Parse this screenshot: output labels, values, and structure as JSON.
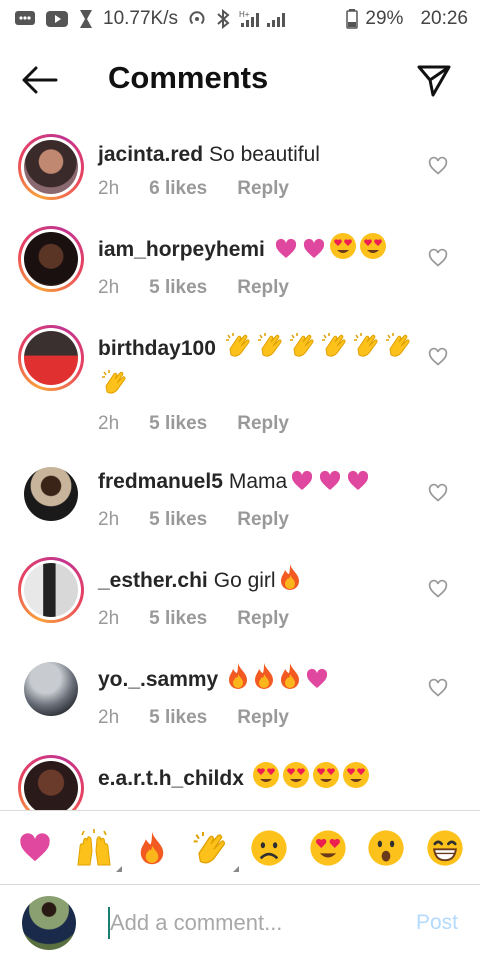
{
  "status": {
    "speed": "10.77K/s",
    "battery": "29%",
    "time": "20:26"
  },
  "header": {
    "title": "Comments"
  },
  "comments": [
    {
      "username": "jacinta.red",
      "text": "So beautiful",
      "emojis": [],
      "time": "2h",
      "likes": "6 likes",
      "reply": "Reply"
    },
    {
      "username": "iam_horpeyhemi",
      "text": "",
      "emojis": [
        "pink-heart",
        "pink-heart",
        "heart-eyes",
        "heart-eyes"
      ],
      "time": "2h",
      "likes": "5 likes",
      "reply": "Reply"
    },
    {
      "username": "birthday100",
      "text": "",
      "emojis": [
        "clap",
        "clap",
        "clap",
        "clap",
        "clap",
        "clap",
        "clap"
      ],
      "time": "2h",
      "likes": "5 likes",
      "reply": "Reply"
    },
    {
      "username": "fredmanuel5",
      "text": "Mama",
      "emojis": [
        "pink-heart",
        "pink-heart",
        "pink-heart"
      ],
      "time": "2h",
      "likes": "5 likes",
      "reply": "Reply"
    },
    {
      "username": "_esther.chi",
      "text": "Go girl",
      "emojis": [
        "fire"
      ],
      "time": "2h",
      "likes": "5 likes",
      "reply": "Reply"
    },
    {
      "username": "yo._.sammy",
      "text": "",
      "emojis": [
        "fire",
        "fire",
        "fire",
        "pink-heart"
      ],
      "time": "2h",
      "likes": "5 likes",
      "reply": "Reply"
    },
    {
      "username": "e.a.r.t.h_childx",
      "text": "",
      "emojis": [
        "heart-eyes",
        "heart-eyes",
        "heart-eyes",
        "heart-eyes"
      ],
      "time": "",
      "likes": "",
      "reply": ""
    }
  ],
  "reactions": [
    "pink-heart",
    "raised-hands",
    "fire",
    "clap",
    "sad-face",
    "heart-eyes",
    "surprised-face",
    "grin-face"
  ],
  "input": {
    "placeholder": "Add a comment...",
    "post_label": "Post"
  },
  "colors": {
    "post_disabled": "#b3dbff",
    "ring_start": "#f9a23a",
    "ring_end": "#c2348f",
    "muted_text": "#999999"
  }
}
